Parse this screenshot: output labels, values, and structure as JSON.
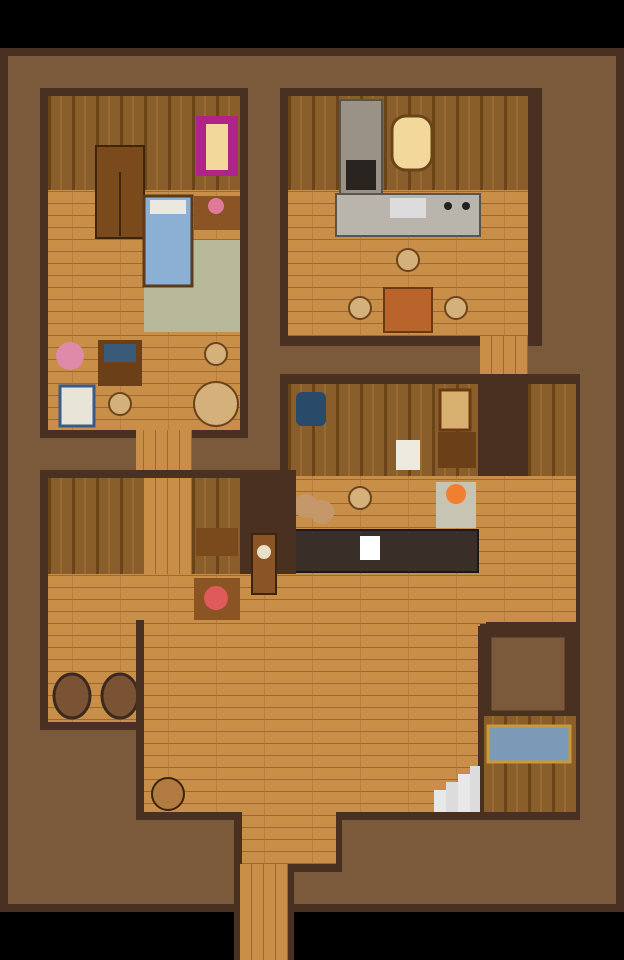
{
  "map": {
    "colors": {
      "void": "#000000",
      "wall_top": "#7a5a3a",
      "wall_edge": "#4a3020",
      "wall_face": "#8a5e2a",
      "wall_face_dark": "#6b4519",
      "floor": "#c98e47",
      "floor_line": "#9c6a30",
      "rug": "#b8b89a",
      "counter": "#3a2f28"
    }
  }
}
